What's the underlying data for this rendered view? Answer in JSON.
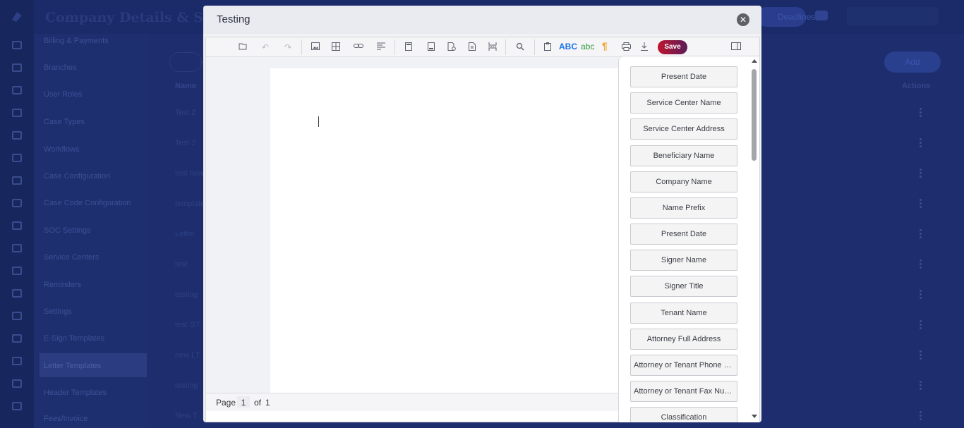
{
  "background": {
    "page_title": "Company Details & Settings",
    "header_pill": "Deadlines",
    "add_button": "Add",
    "columns": {
      "name": "Name",
      "actions": "Actions"
    },
    "sidebar_items": [
      "Billing & Payments",
      "Branches",
      "User Roles",
      "Case Types",
      "Workflows",
      "Case Configuration",
      "Case Code Configuration",
      "SOC Settings",
      "Service Centers",
      "Reminders",
      "Settings",
      "E-Sign Templates",
      "Letter Templates",
      "Header Templates",
      "Fees/Invoice"
    ],
    "active_sidebar_index": 12,
    "rows": [
      "Test 2",
      "Test 2",
      "test new",
      "template",
      "Letter",
      "test",
      "testing",
      "test GT",
      "new LT",
      "testing",
      "New T"
    ]
  },
  "modal": {
    "title": "Testing",
    "close_icon": "close-icon"
  },
  "toolbar": {
    "icons": [
      "open-folder-icon",
      "undo-icon",
      "redo-icon",
      "image-icon",
      "table-icon",
      "link-icon",
      "paragraph-align-icon",
      "header-icon",
      "footer-icon",
      "page-setup-icon",
      "page-number-icon",
      "break-icon",
      "find-icon",
      "clipboard-icon",
      "print-icon",
      "download-icon",
      "toggle-panel-icon"
    ],
    "spell_upper": "ABC",
    "spell_lower": "abc",
    "pilcrow": "¶",
    "save_label": "Save",
    "colors": {
      "spell_upper": "#1a73e8",
      "spell_lower": "#2e9b3a",
      "pilcrow": "#f0a830",
      "save_from": "#c0152e",
      "save_to": "#5b1c58"
    }
  },
  "status": {
    "page_label": "Page",
    "current_page": "1",
    "of_label": "of",
    "total_pages": "1"
  },
  "fields": [
    "Present Date",
    "Service Center Name",
    "Service Center Address",
    "Beneficiary Name",
    "Company Name",
    "Name Prefix",
    "Present Date",
    "Signer Name",
    "Signer Title",
    "Tenant Name",
    "Attorney Full Address",
    "Attorney or Tenant Phone Number",
    "Attorney or Tenant Fax Number",
    "Classification"
  ]
}
